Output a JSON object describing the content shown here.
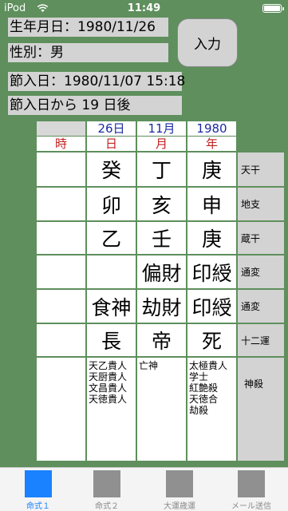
{
  "statusbar": {
    "device": "iPod",
    "time": "11:49"
  },
  "info": {
    "birth": "生年月日：1980/11/26",
    "gender": "性別：男",
    "setsu": "節入日：1980/11/07 15:18",
    "days": "節入日から 19 日後"
  },
  "input_button": "入力",
  "header": {
    "top": [
      "",
      "26日",
      "11月",
      "1980"
    ],
    "bottom": [
      "時",
      "日",
      "月",
      "年"
    ]
  },
  "rows": [
    {
      "cells": [
        "",
        "癸",
        "丁",
        "庚"
      ],
      "label": "天干"
    },
    {
      "cells": [
        "",
        "卯",
        "亥",
        "申"
      ],
      "label": "地支"
    },
    {
      "cells": [
        "",
        "乙",
        "壬",
        "庚"
      ],
      "label": "蔵干"
    },
    {
      "cells": [
        "",
        "",
        "偏財",
        "印綬"
      ],
      "label": "通変"
    },
    {
      "cells": [
        "",
        "食神",
        "劫財",
        "印綬"
      ],
      "label": "通変"
    },
    {
      "cells": [
        "",
        "長",
        "帝",
        "死"
      ],
      "label": "十二運"
    }
  ],
  "shinsatsu": {
    "label": "神殺",
    "hour": [],
    "day": [
      "天乙貴人",
      "天厨貴人",
      "文昌貴人",
      "天徳貴人"
    ],
    "month": [
      "亡神"
    ],
    "year": [
      "太極貴人",
      "学士",
      "紅艶殺",
      "天徳合",
      "劫殺"
    ]
  },
  "tabs": [
    {
      "label": "命式１",
      "active": true
    },
    {
      "label": "命式２",
      "active": false
    },
    {
      "label": "大運歳運",
      "active": false
    },
    {
      "label": "メール送信",
      "active": false
    }
  ]
}
